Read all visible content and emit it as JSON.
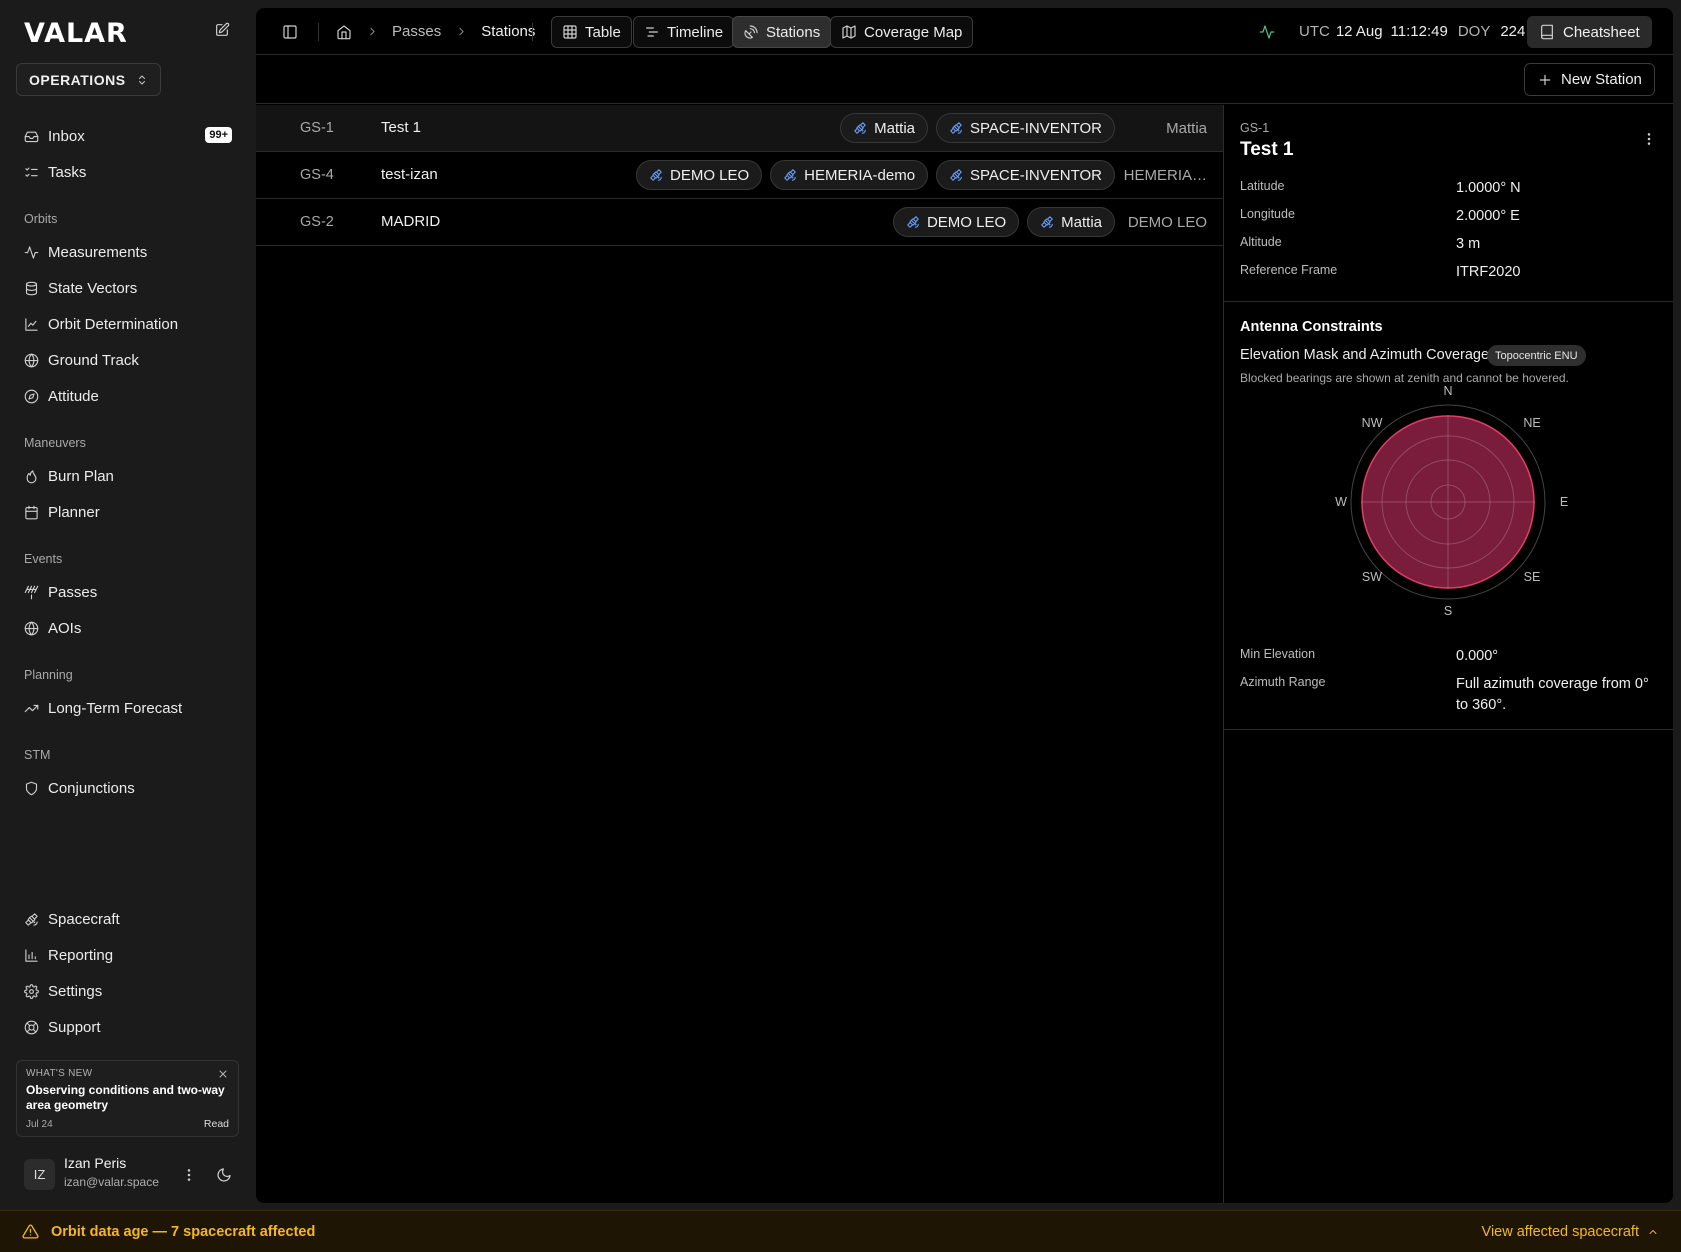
{
  "sidebar": {
    "logo": "VALAR",
    "org": "OPERATIONS",
    "inbox": {
      "label": "Inbox",
      "badge": "99+"
    },
    "tasks": "Tasks",
    "sections": {
      "orbits": "Orbits",
      "maneuvers": "Maneuvers",
      "events": "Events",
      "planning": "Planning",
      "stm": "STM"
    },
    "items": {
      "measurements": "Measurements",
      "state_vectors": "State Vectors",
      "orbit_determination": "Orbit Determination",
      "ground_track": "Ground Track",
      "attitude": "Attitude",
      "burn_plan": "Burn Plan",
      "planner": "Planner",
      "passes": "Passes",
      "aois": "AOIs",
      "long_term_forecast": "Long-Term Forecast",
      "conjunctions": "Conjunctions",
      "spacecraft": "Spacecraft",
      "reporting": "Reporting",
      "settings": "Settings",
      "support": "Support"
    },
    "whats_new": {
      "label": "WHAT'S NEW",
      "title": "Observing conditions and two-way area geometry",
      "date": "Jul 24",
      "read": "Read"
    },
    "user": {
      "initials": "IZ",
      "name": "Izan Peris",
      "email": "izan@valar.space"
    }
  },
  "header": {
    "breadcrumb": [
      "Passes",
      "Stations"
    ],
    "views": {
      "table": "Table",
      "timeline": "Timeline",
      "stations": "Stations",
      "coverage_map": "Coverage Map"
    },
    "selected_view": "Stations",
    "utc_label": "UTC",
    "date": "12 Aug",
    "time": "11:12:49",
    "doy_label": "DOY",
    "doy": "224",
    "cheatsheet": "Cheatsheet"
  },
  "toolbar": {
    "new_station": "New Station"
  },
  "stations": [
    {
      "id": "GS-1",
      "name": "Test 1",
      "tags": [
        "Mattia",
        "SPACE-INVENTOR"
      ],
      "owner": "Mattia"
    },
    {
      "id": "GS-4",
      "name": "test-izan",
      "tags": [
        "DEMO LEO",
        "HEMERIA-demo",
        "SPACE-INVENTOR"
      ],
      "owner": "HEMERIA…"
    },
    {
      "id": "GS-2",
      "name": "MADRID",
      "tags": [
        "DEMO LEO",
        "Mattia"
      ],
      "owner": "DEMO LEO"
    }
  ],
  "detail": {
    "id": "GS-1",
    "name": "Test 1",
    "fields": {
      "latitude_label": "Latitude",
      "latitude": "1.0000° N",
      "longitude_label": "Longitude",
      "longitude": "2.0000° E",
      "altitude_label": "Altitude",
      "altitude": "3 m",
      "frame_label": "Reference Frame",
      "frame": "ITRF2020"
    },
    "antenna": {
      "title": "Antenna Constraints",
      "subtitle": "Elevation Mask and Azimuth Coverage",
      "frame_pill": "Topocentric ENU",
      "note": "Blocked bearings are shown at zenith and cannot be hovered.",
      "compass": {
        "n": "N",
        "ne": "NE",
        "e": "E",
        "se": "SE",
        "s": "S",
        "sw": "SW",
        "w": "W",
        "nw": "NW"
      },
      "min_elevation_label": "Min Elevation",
      "min_elevation": "0.000°",
      "azimuth_range_label": "Azimuth Range",
      "azimuth_range": "Full azimuth coverage from 0° to 360°.",
      "min_elevation_deg": 0,
      "azimuth_from_deg": 0,
      "azimuth_to_deg": 360,
      "fill_color": "#7a1c3c",
      "stroke_color": "#e23d6b"
    }
  },
  "alert": {
    "text": "Orbit data age — 7 spacecraft affected",
    "action": "View affected spacecraft",
    "color": "#f5b820",
    "background": "#1e1505"
  },
  "colors": {
    "tag_icon": "#6ea0ff",
    "accent_pulse": "#4cc38a"
  }
}
